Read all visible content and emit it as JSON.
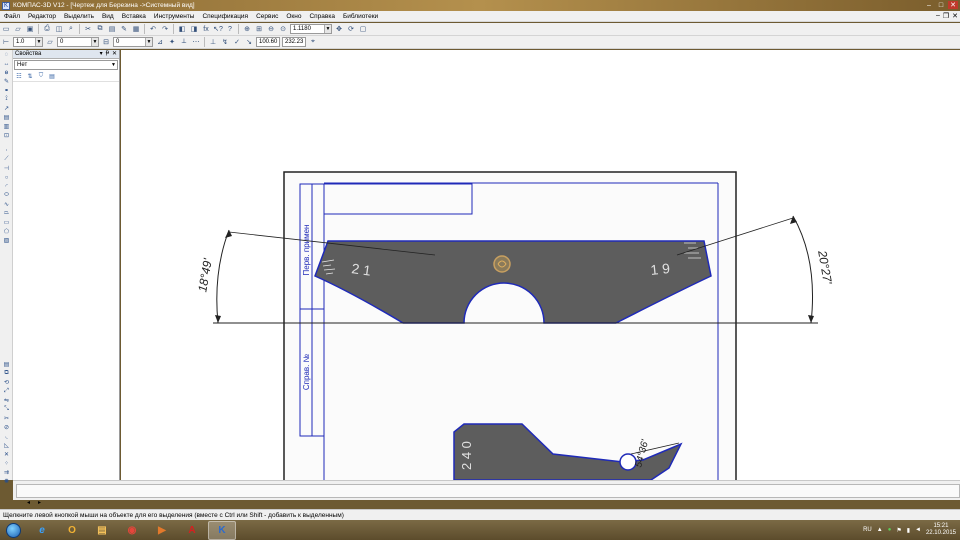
{
  "window": {
    "app_letter": "K",
    "title": "КОМПАС-3D V12 - [Чертеж для Березина ->Системный вид]",
    "controls": {
      "minimize": "–",
      "maximize": "□",
      "close": "✕"
    }
  },
  "menu": {
    "items": [
      "Файл",
      "Редактор",
      "Выделить",
      "Вид",
      "Вставка",
      "Инструменты",
      "Спецификация",
      "Сервис",
      "Окно",
      "Справка",
      "Библиотеки"
    ],
    "mdi_controls": {
      "minimize": "–",
      "restore": "❐",
      "close": "✕"
    }
  },
  "toolbar1": {
    "zoom_value": "1.1180"
  },
  "toolbar2": {
    "line_scale": "1.0",
    "layer": "0",
    "style": "0",
    "coord_x": "100.60",
    "coord_y": "232.23"
  },
  "properties_panel": {
    "title": "Свойства",
    "header_buttons": {
      "dropdown": "▾",
      "pin": "ᵽ",
      "close": "✕"
    },
    "object_select": "Нет"
  },
  "drawing": {
    "title_block": {
      "perv_primen": "Перв. примен",
      "sprav_no": "Справ. №"
    },
    "angle_left": "18°49'",
    "angle_right": "20°27'",
    "mark_21": "2 1",
    "mark_19": "1 9",
    "part2_label": "2 4 0",
    "angle_bottom": "54°36'"
  },
  "scroll_arrows": {
    "left": "◂",
    "right": "▸"
  },
  "status": {
    "hint": "Щелкните левой кнопкой мыши на объекте для его выделения (вместе с Ctrl или Shift - добавить к выделенным)"
  },
  "taskbar": {
    "apps": [
      {
        "name": "ie",
        "glyph": "e",
        "color": "#3aa2ff"
      },
      {
        "name": "outlook",
        "glyph": "O",
        "color": "#f2b233"
      },
      {
        "name": "explorer",
        "glyph": "▤",
        "color": "#f4c15a"
      },
      {
        "name": "chrome",
        "glyph": "◉",
        "color": "#e6453b"
      },
      {
        "name": "media",
        "glyph": "▶",
        "color": "#e3792b"
      },
      {
        "name": "acrobat",
        "glyph": "A",
        "color": "#d71f1f"
      },
      {
        "name": "kompas",
        "glyph": "K",
        "color": "#2a6ad0"
      }
    ],
    "lang": "RU",
    "time": "15:21",
    "date": "22.10.2015"
  },
  "colors": {
    "accent_outline": "#1f2ab8",
    "part_fill": "#5d5d5d"
  }
}
